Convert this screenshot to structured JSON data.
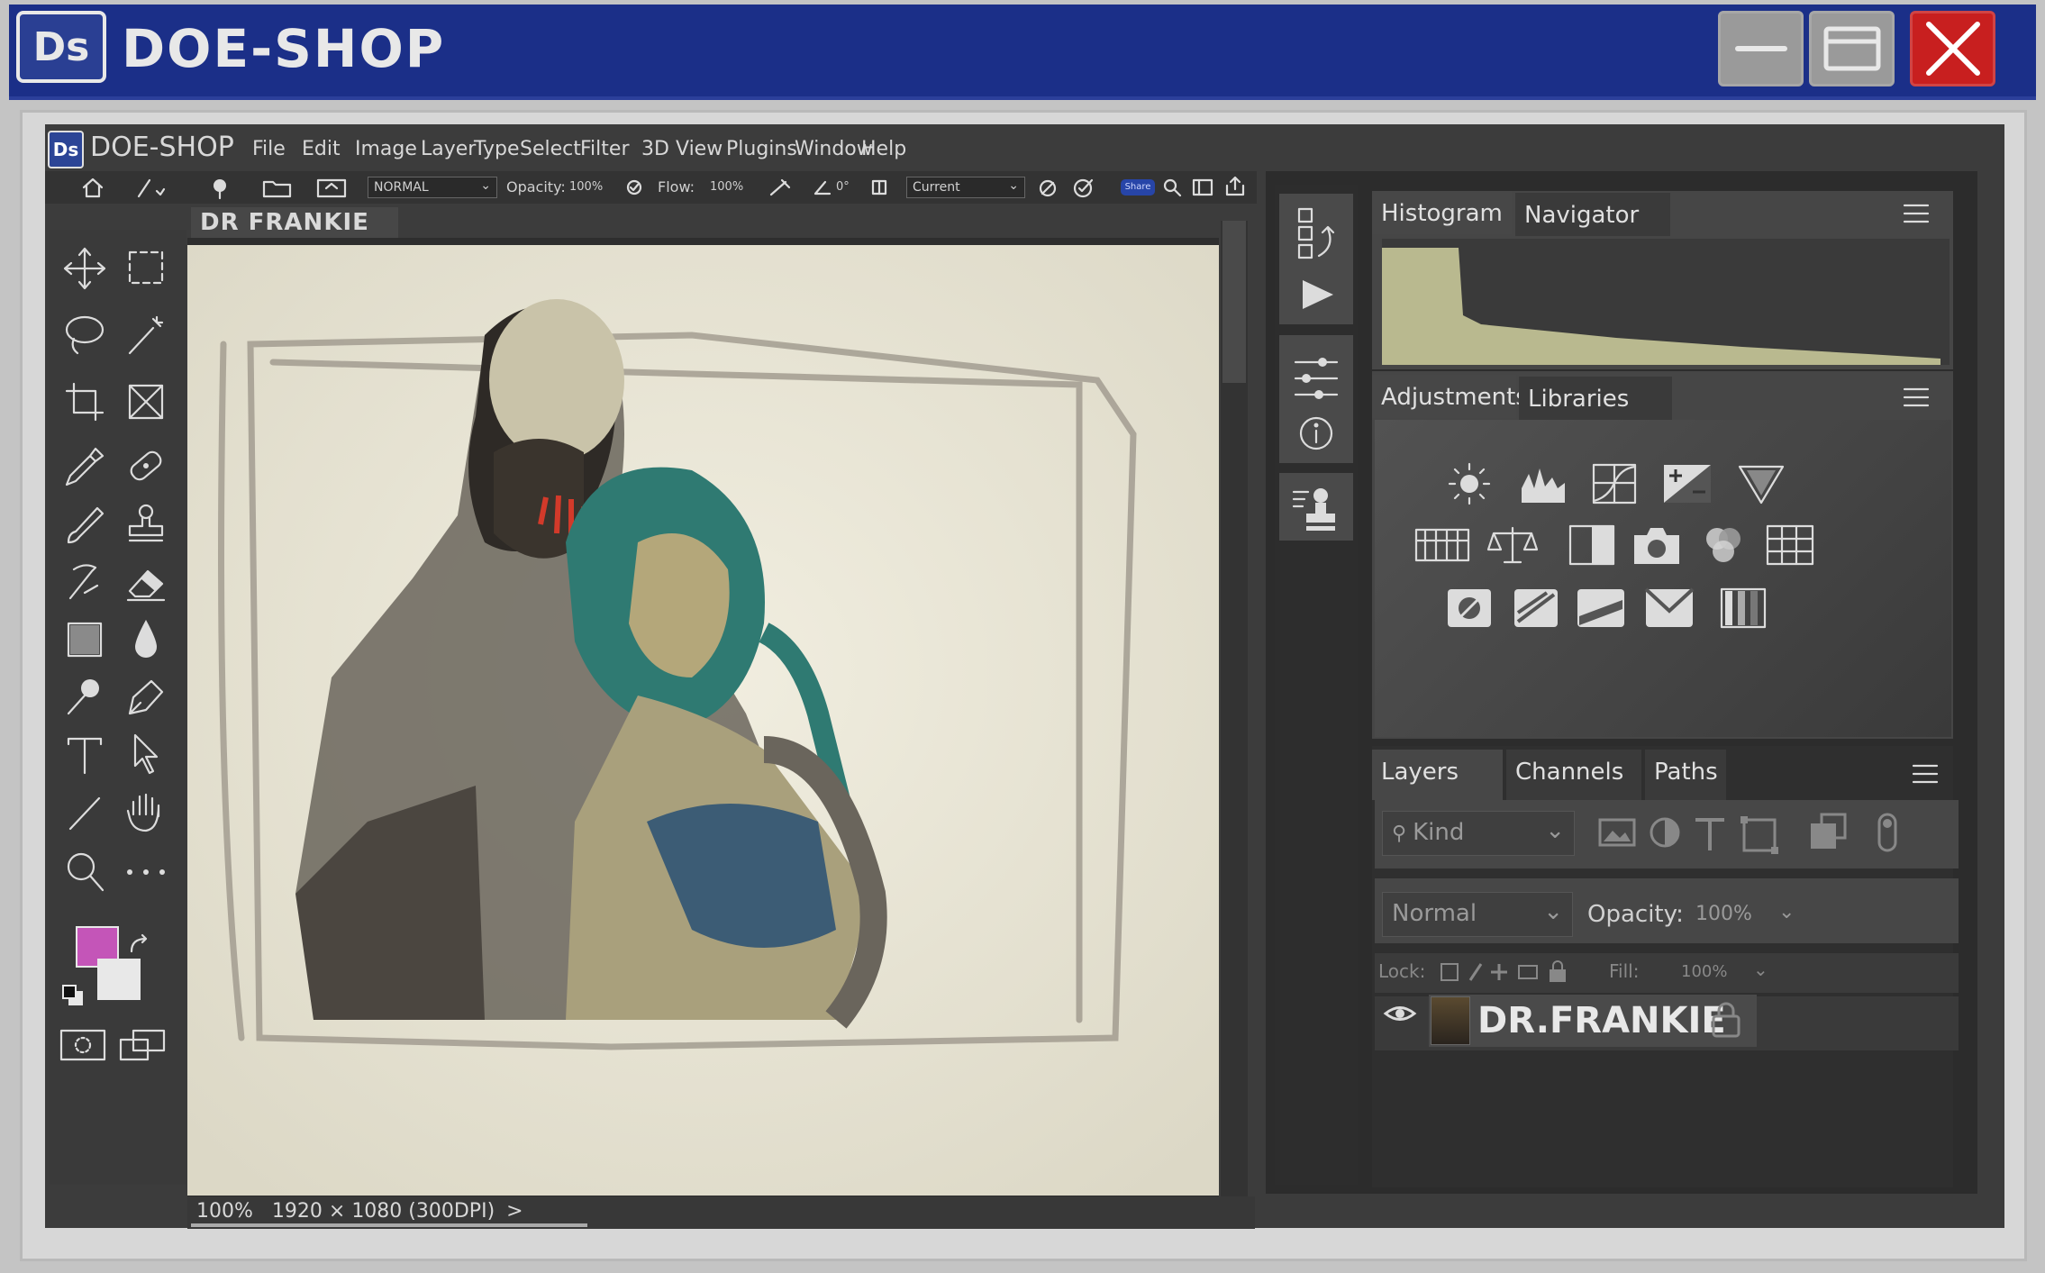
{
  "window": {
    "logo": "Ds",
    "title": "DOE-SHOP",
    "controls": [
      "minimize-icon",
      "maximize-icon",
      "close-icon"
    ],
    "close_color": "#c81f1f",
    "titlebar_color": "#1b2f88"
  },
  "app": {
    "logo": "Ds",
    "name": "DOE-SHOP",
    "menu": [
      "File",
      "Edit",
      "Image",
      "Layer",
      "Type",
      "Select",
      "Filter",
      "3D",
      "View",
      "Plugins",
      "Window",
      "Help"
    ]
  },
  "options_bar": {
    "blend_mode": "NORMAL",
    "opacity_label": "Opacity:",
    "opacity_value": "100%",
    "flow_label": "Flow:",
    "flow_value": "100%",
    "angle_value": "0°",
    "sample": "Current",
    "share_label": "Share"
  },
  "document": {
    "tab_title": "DR FRANKIE",
    "zoom": "100%",
    "dimensions": "1920 × 1080 (300DPI)",
    "status_arrow": ">"
  },
  "tools": [
    "move-icon",
    "marquee-icon",
    "lasso-icon",
    "magic-wand-icon",
    "crop-icon",
    "frame-icon",
    "eyedropper-icon",
    "healing-icon",
    "brush-icon",
    "stamp-icon",
    "history-brush-icon",
    "eraser-icon",
    "gradient-icon",
    "blur-icon",
    "dodge-icon",
    "pen-icon",
    "type-icon",
    "path-select-icon",
    "line-icon",
    "hand-icon",
    "zoom-icon",
    "more-icon"
  ],
  "colors": {
    "foreground": "#c455b8",
    "background": "#e8e8e8"
  },
  "panels": {
    "top_tabs": [
      "Histogram",
      "Navigator"
    ],
    "mid_tabs": [
      "Adjustments",
      "Libraries"
    ],
    "layers_tabs": [
      "Layers",
      "Channels",
      "Paths"
    ],
    "adjustment_icons": [
      "brightness-icon",
      "levels-icon",
      "curves-icon",
      "exposure-icon",
      "gradient-triangle-icon",
      "hue-bars-icon",
      "balance-icon",
      "bw-icon",
      "photo-filter-icon",
      "channel-mixer-icon",
      "color-lookup-icon",
      "invert-icon",
      "posterize-icon",
      "threshold-icon",
      "gradient-map-icon",
      "selective-color-icon"
    ],
    "layers": {
      "filter_placeholder": "Kind",
      "blend_mode": "Normal",
      "opacity_label": "Opacity:",
      "opacity_value": "100%",
      "lock_label": "Lock:",
      "fill_label": "Fill:",
      "fill_value": "100%",
      "items": [
        {
          "name": "DR.FRANKIE",
          "visible": true,
          "locked": true
        }
      ]
    },
    "histogram_color": "#b9b98f"
  }
}
